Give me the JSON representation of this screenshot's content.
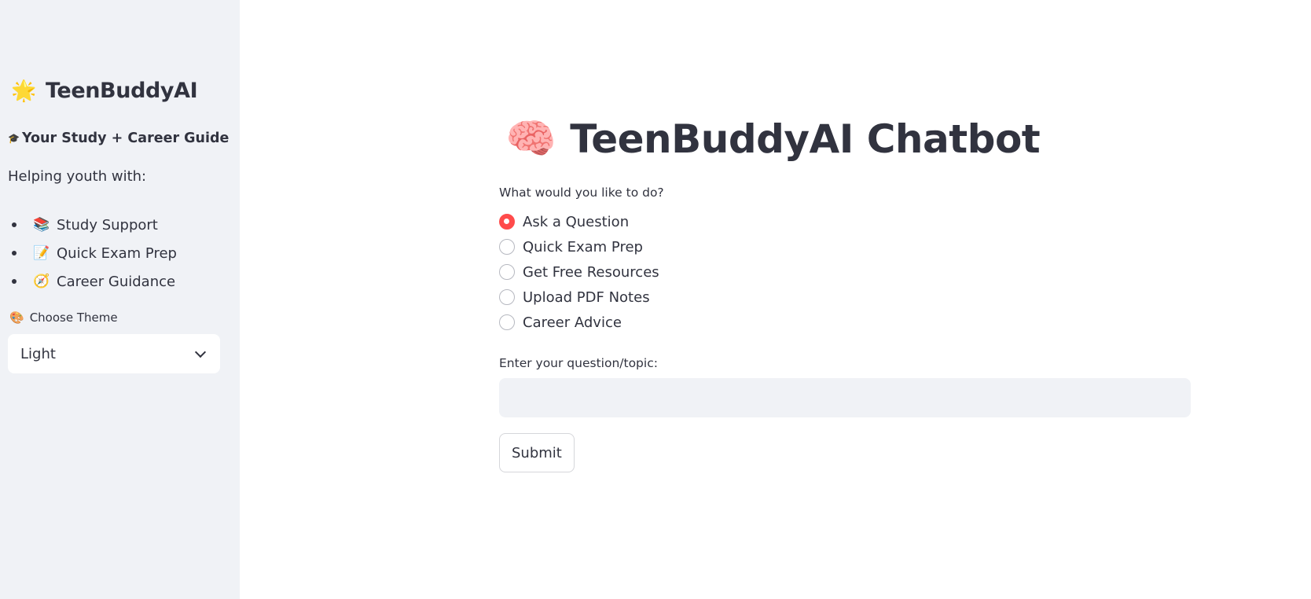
{
  "sidebar": {
    "title_emoji": "🌟",
    "title": "TeenBuddyAI",
    "subtitle_emoji": "🎓",
    "subtitle": "Your Study + Career Guide",
    "helping_text": "Helping youth with:",
    "items": [
      {
        "emoji": "📚",
        "label": "Study Support"
      },
      {
        "emoji": "📝",
        "label": "Quick Exam Prep"
      },
      {
        "emoji": "🧭",
        "label": "Career Guidance"
      }
    ],
    "theme_label_emoji": "🎨",
    "theme_label": "Choose Theme",
    "theme_value": "Light"
  },
  "main": {
    "title_emoji": "🧠",
    "title": "TeenBuddyAI Chatbot",
    "question_label": "What would you like to do?",
    "options": [
      {
        "label": "Ask a Question",
        "selected": true
      },
      {
        "label": "Quick Exam Prep",
        "selected": false
      },
      {
        "label": "Get Free Resources",
        "selected": false
      },
      {
        "label": "Upload PDF Notes",
        "selected": false
      },
      {
        "label": "Career Advice",
        "selected": false
      }
    ],
    "input_label": "Enter your question/topic:",
    "input_value": "",
    "input_placeholder": "",
    "submit_label": "Submit"
  },
  "colors": {
    "accent": "#ff4b4b",
    "sidebar_bg": "#f0f2f6",
    "text": "#31333f"
  }
}
